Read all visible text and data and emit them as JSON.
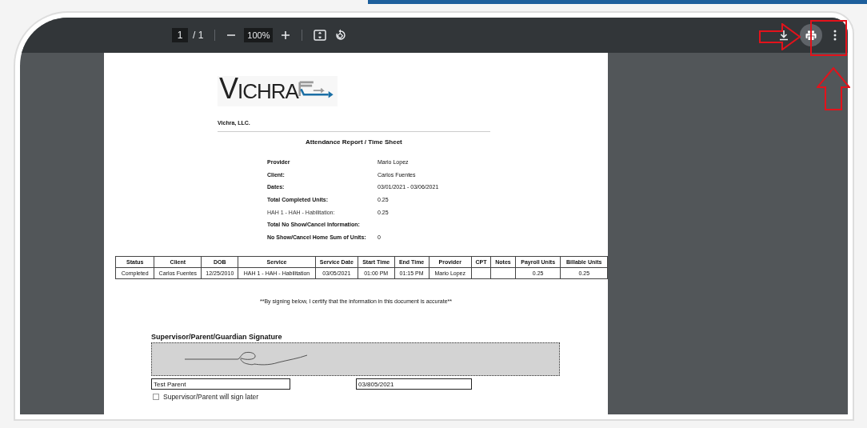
{
  "toolbar": {
    "page_current": "1",
    "page_total": "/ 1",
    "zoom": "100%"
  },
  "document": {
    "logo_text": "VICHRA",
    "company": "Vichra, LLC.",
    "title": "Attendance Report / Time Sheet",
    "info": [
      {
        "label": "Provider",
        "value": "Mario Lopez",
        "bold": true
      },
      {
        "label": "Client:",
        "value": "Carlos Fuentes",
        "bold": true
      },
      {
        "label": "Dates:",
        "value": "03/01/2021 - 03/06/2021",
        "bold": true
      },
      {
        "label": "Total Completed Units:",
        "value": "0.25",
        "bold": true
      },
      {
        "label": "HAH 1 - HAH - Habilitation:",
        "value": "0.25",
        "bold": false
      },
      {
        "label": "Total No Show/Cancel Information:",
        "bold": true
      },
      {
        "label": "No Show/Cancel Home Sum of Units:",
        "value": "0",
        "bold": true
      }
    ],
    "table": {
      "columns": [
        "Status",
        "Client",
        "DOB",
        "Service",
        "Service Date",
        "Start Time",
        "End Time",
        "Provider",
        "CPT",
        "Notes",
        "Payroll Units",
        "Billable Units"
      ],
      "rows": [
        [
          "Completed",
          "Carlos Fuentes",
          "12/25/2010",
          "HAH 1 - HAH - Habilitation",
          "03/05/2021",
          "01:00 PM",
          "01:15 PM",
          "Mario Lopez",
          "",
          "",
          "0.25",
          "0.25"
        ]
      ]
    },
    "certification": "**By signing below, I certify that the information in this document is accurate**",
    "signature": {
      "heading": "Supervisor/Parent/Guardian Signature",
      "name": "Test Parent",
      "date": "03/805/2021",
      "sign_later": {
        "label": "Supervisor/Parent will sign later",
        "checked": false
      }
    }
  }
}
